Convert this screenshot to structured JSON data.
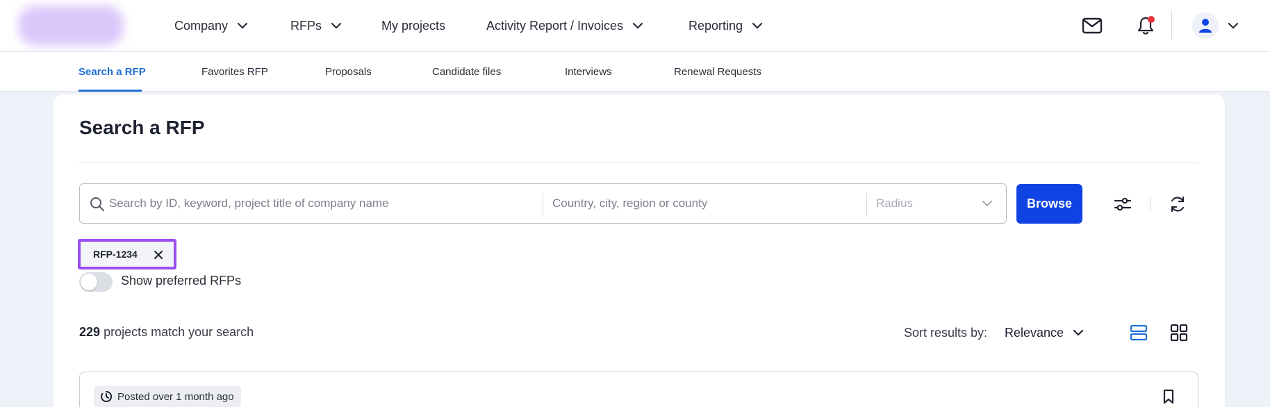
{
  "nav": {
    "items": [
      {
        "label": "Company",
        "dropdown": true
      },
      {
        "label": "RFPs",
        "dropdown": true
      },
      {
        "label": "My projects",
        "dropdown": false
      },
      {
        "label": "Activity Report / Invoices",
        "dropdown": true
      },
      {
        "label": "Reporting",
        "dropdown": true
      }
    ],
    "icons": [
      "mail-icon",
      "notification-bell-icon",
      "user-avatar-icon",
      "chevron-down-icon"
    ],
    "notification_dot_color": "#e8333a"
  },
  "tabs": {
    "items": [
      "Search a RFP",
      "Favorites RFP",
      "Proposals",
      "Candidate files",
      "Interviews",
      "Renewal Requests"
    ],
    "active": "Search a RFP",
    "accent": "#1f6fd6"
  },
  "page": {
    "title": "Search a RFP"
  },
  "search": {
    "keyword_placeholder": "Search by ID, keyword, project title of company name",
    "location_placeholder": "Country, city, region or county",
    "radius_placeholder": "Radius",
    "browse_label": "Browse",
    "browse_color": "#1043e4"
  },
  "filter_chip": {
    "label": "RFP-1234",
    "highlight_color": "#9b4ff2"
  },
  "preferred_toggle": {
    "label": "Show preferred RFPs",
    "on": false
  },
  "results": {
    "count": "229",
    "count_suffix": "projects match your search",
    "sort_label": "Sort results by:",
    "sort_value": "Relevance",
    "view_mode": "list"
  },
  "result_card": {
    "posted": "Posted over 1 month ago"
  }
}
